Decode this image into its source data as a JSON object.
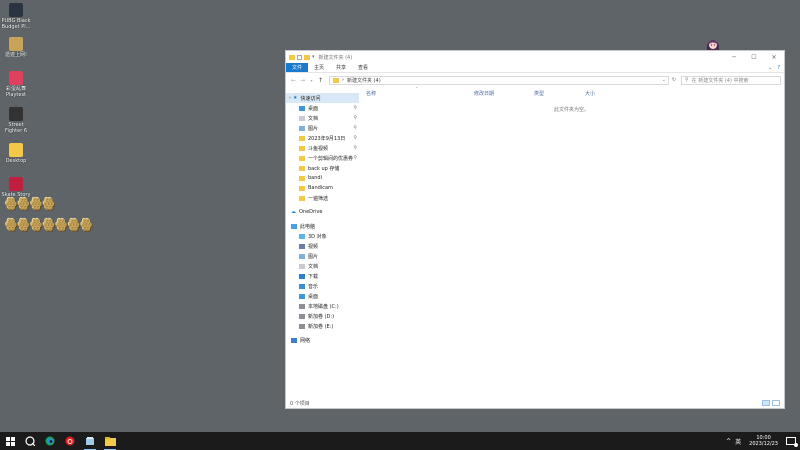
{
  "desktop": {
    "icons": [
      {
        "label": "PUBG Black\nBudget Pl...",
        "icon": "pubg-icon",
        "color": "#2a3340"
      },
      {
        "label": "遗迹上网!",
        "icon": "game-icon",
        "color": "#c9a35a"
      },
      {
        "label": "彩蛋乱舞\nPlaytest",
        "icon": "playtest-icon",
        "color": "#e04060"
      },
      {
        "label": "Street\nFighter 6",
        "icon": "street-fighter-icon",
        "color": "#333333"
      },
      {
        "label": "Desktop",
        "icon": "folder-icon",
        "color": "#f4c94a"
      },
      {
        "label": "Skate Story",
        "icon": "skate-icon",
        "color": "#c02040"
      }
    ],
    "deco_lines": [
      "ꙮꙮꙮꙮ",
      "ꙮꙮꙮꙮꙮꙮꙮ"
    ]
  },
  "explorer": {
    "title": "新建文件夹 (4)",
    "ribbon_tabs": [
      "文件",
      "主页",
      "共享",
      "查看"
    ],
    "address": "新建文件夹 (4)",
    "address_arrow": "›",
    "search_placeholder": "在 新建文件夹 (4) 中搜索",
    "nav": {
      "quick_access": "快速访问",
      "quick_items": [
        {
          "label": "桌面",
          "icon": "desktop-icon",
          "pinned": true
        },
        {
          "label": "文档",
          "icon": "documents-icon",
          "pinned": true
        },
        {
          "label": "图片",
          "icon": "pictures-icon",
          "pinned": true
        },
        {
          "label": "2023年9月13日",
          "icon": "folder-icon",
          "pinned": true
        },
        {
          "label": "斗鱼视频",
          "icon": "folder-icon",
          "pinned": true
        },
        {
          "label": "一个剪辑间的优惠券",
          "icon": "folder-icon",
          "pinned": true
        },
        {
          "label": "back up 存储",
          "icon": "folder-icon",
          "pinned": false
        },
        {
          "label": "bandi",
          "icon": "folder-icon",
          "pinned": false
        },
        {
          "label": "Bandicam",
          "icon": "folder-icon",
          "pinned": false
        },
        {
          "label": "一遍筛选",
          "icon": "folder-icon",
          "pinned": false
        }
      ],
      "onedrive": "OneDrive",
      "this_pc": "此电脑",
      "pc_items": [
        {
          "label": "3D 对象",
          "icon": "3d-objects-icon"
        },
        {
          "label": "视频",
          "icon": "videos-icon"
        },
        {
          "label": "图片",
          "icon": "pictures-icon"
        },
        {
          "label": "文档",
          "icon": "documents-icon"
        },
        {
          "label": "下载",
          "icon": "downloads-icon"
        },
        {
          "label": "音乐",
          "icon": "music-icon"
        },
        {
          "label": "桌面",
          "icon": "desktop-icon"
        },
        {
          "label": "本地磁盘 (C:)",
          "icon": "drive-icon"
        },
        {
          "label": "新加卷 (D:)",
          "icon": "drive-icon"
        },
        {
          "label": "新加卷 (E:)",
          "icon": "drive-icon"
        }
      ],
      "network": "网络"
    },
    "columns": [
      "名称",
      "修改日期",
      "类型",
      "大小"
    ],
    "empty_message": "此文件夹为空。",
    "status": "0 个项目"
  },
  "taskbar": {
    "ime": "英",
    "time": "10:00",
    "date": "2023/12/23"
  }
}
